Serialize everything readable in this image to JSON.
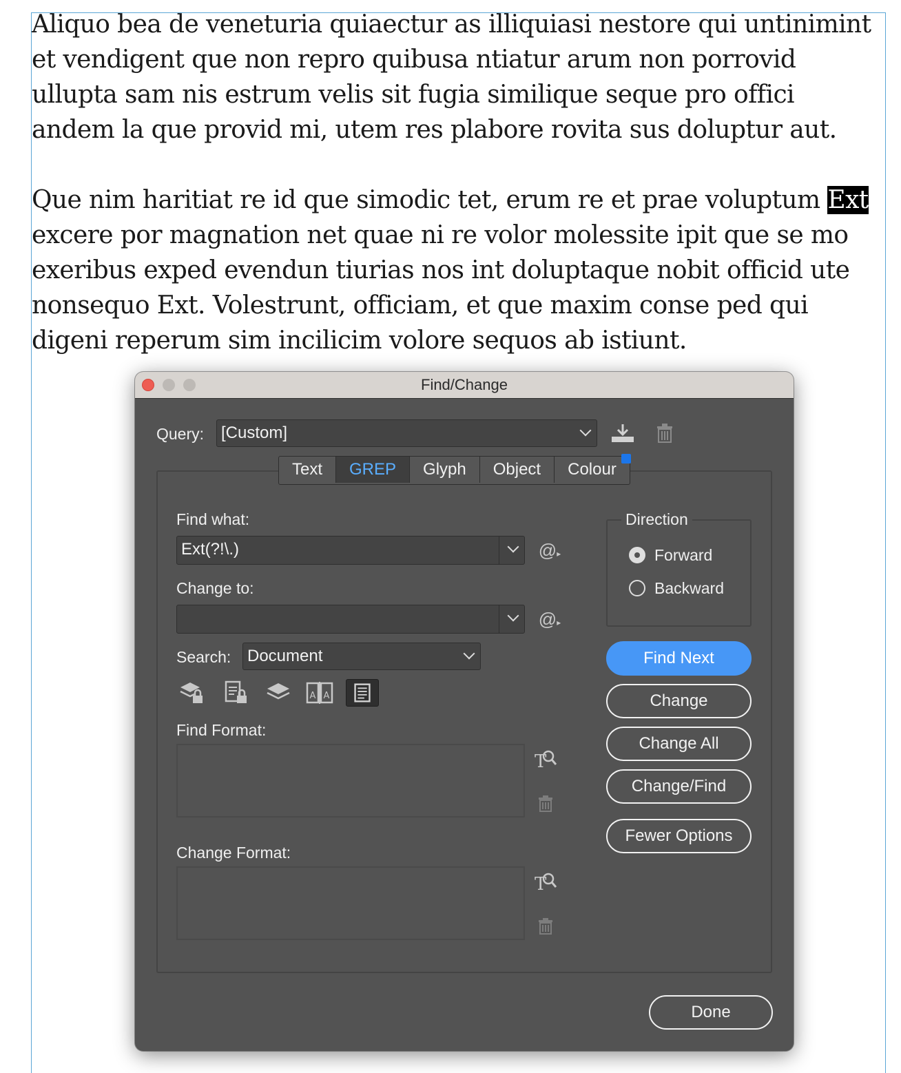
{
  "document": {
    "paragraph1": "Aliquo bea de veneturia quiaectur as illiquiasi nestore qui untinimint et vendigent que non repro quibusa ntiatur arum non porrovid ullupta sam nis estrum velis sit fugia similique seque pro offici andem la que provid mi, utem res plabore rovita sus doluptur aut.",
    "paragraph2_before": "Que nim haritiat re id que simodic tet, erum re et prae voluptum ",
    "paragraph2_highlight": "Ext",
    "paragraph2_after": " excere por magnation net quae ni re volor molessite ipit que se mo exeribus exped evendun tiurias nos int doluptaque nobit officid ute nonsequo Ext. Volestrunt, officiam, et que maxim conse ped qui digeni reperum sim incilicim volore sequos ab istiunt."
  },
  "dialog": {
    "title": "Find/Change",
    "query_label": "Query:",
    "query_value": "[Custom]",
    "tabs": [
      {
        "label": "Text"
      },
      {
        "label": "GREP"
      },
      {
        "label": "Glyph"
      },
      {
        "label": "Object"
      },
      {
        "label": "Colour"
      }
    ],
    "active_tab": "GREP",
    "find_what_label": "Find what:",
    "find_what_value": "Ext(?!\\.)",
    "change_to_label": "Change to:",
    "change_to_value": "",
    "special_char_icon": "@",
    "search_label": "Search:",
    "search_value": "Document",
    "find_format_label": "Find Format:",
    "change_format_label": "Change Format:",
    "direction": {
      "label": "Direction",
      "forward": "Forward",
      "backward": "Backward",
      "selected": "Forward"
    },
    "buttons": {
      "find_next": "Find Next",
      "change": "Change",
      "change_all": "Change All",
      "change_find": "Change/Find",
      "fewer_options": "Fewer Options",
      "done": "Done"
    }
  },
  "colors": {
    "dialog_bg": "#535353",
    "accent": "#4797f6",
    "active_tab_text": "#5aaeff",
    "badge": "#1c76ea"
  },
  "icons": [
    "save-query-icon",
    "delete-query-icon",
    "special-characters-icon",
    "include-locked-layers-icon",
    "include-locked-stories-icon",
    "include-hidden-layers-icon",
    "include-master-pages-icon",
    "include-footnotes-icon",
    "specify-attributes-icon",
    "clear-attributes-icon"
  ]
}
